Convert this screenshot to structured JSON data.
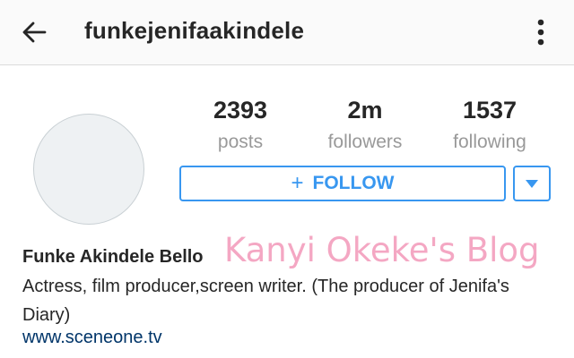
{
  "header": {
    "title": "funkejenifaakindele",
    "back_icon": "arrow-left-icon",
    "menu_icon": "more-vertical-icon"
  },
  "profile": {
    "stats": [
      {
        "value": "2393",
        "label": "posts"
      },
      {
        "value": "2m",
        "label": "followers"
      },
      {
        "value": "1537",
        "label": "following"
      }
    ],
    "follow_label": "FOLLOW",
    "follow_icon": "plus-icon",
    "dropdown_icon": "caret-down-icon",
    "display_name": "Funke Akindele Bello",
    "bio": "Actress, film producer,screen writer. (The producer of Jenifa's Diary)",
    "website": "www.sceneone.tv"
  },
  "watermark": "Kanyi Okeke's Blog",
  "colors": {
    "accent": "#3897f0",
    "link": "#003569",
    "watermark": "#f4a7c3",
    "muted": "#999999"
  }
}
